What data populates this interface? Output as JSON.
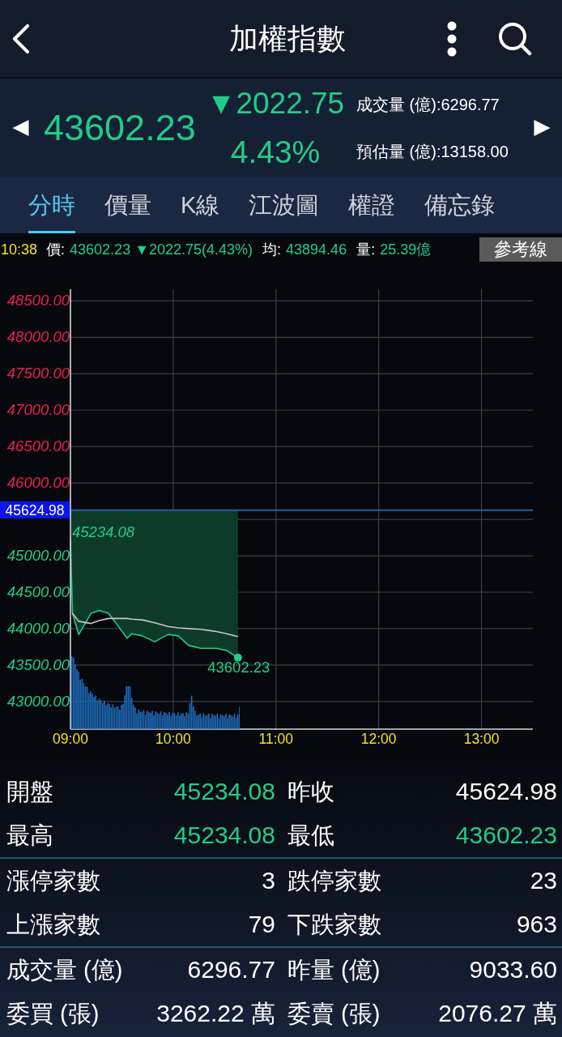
{
  "header": {
    "title": "加權指數"
  },
  "quote": {
    "price": "43602.23",
    "change": "▼2022.75",
    "percent": "4.43%",
    "volume": "成交量 (億):6296.77",
    "estimate": "預估量 (億):13158.00"
  },
  "tabs": [
    {
      "label": "分時",
      "selected": true
    },
    {
      "label": "價量",
      "selected": false
    },
    {
      "label": "K線",
      "selected": false
    },
    {
      "label": "江波圖",
      "selected": false
    },
    {
      "label": "權證",
      "selected": false
    },
    {
      "label": "備忘錄",
      "selected": false
    }
  ],
  "info_bar": {
    "time": "10:38",
    "items": [
      {
        "label": "價:",
        "value": "43602.23 ▼2022.75(4.43%)"
      },
      {
        "label": "均:",
        "value": "43894.46"
      },
      {
        "label": "量:",
        "value": "25.39億"
      }
    ],
    "button": "參考線"
  },
  "chart": {
    "chart_data": {
      "type": "line",
      "x": [
        9,
        9.02,
        9.08,
        9.2,
        9.28,
        9.37,
        9.43,
        9.55,
        9.6,
        9.7,
        9.82,
        9.95,
        10.05,
        10.15,
        10.27,
        10.42,
        10.52,
        10.63
      ],
      "series": [
        {
          "color": "#22cc88",
          "values": [
            45230,
            44210,
            43920,
            44210,
            44250,
            44210,
            44100,
            43870,
            43930,
            43900,
            43820,
            43920,
            43900,
            43770,
            43730,
            43730,
            43700,
            43600
          ]
        },
        {
          "color": "#c8c8c8",
          "values": [
            null,
            44210,
            44100,
            44070,
            44110,
            44140,
            44140,
            44140,
            44130,
            44120,
            44080,
            44030,
            44010,
            44000,
            43990,
            43960,
            43930,
            43890
          ]
        }
      ],
      "xlim": [
        9,
        13.5
      ],
      "ylim": [
        42620,
        48660
      ],
      "grid": true,
      "xticks": [
        {
          "value": 9,
          "label": "09:00"
        },
        {
          "value": 10,
          "label": "10:00"
        },
        {
          "value": 11,
          "label": "11:00"
        },
        {
          "value": 12,
          "label": "12:00"
        },
        {
          "value": 13,
          "label": "13:00"
        }
      ],
      "yticks": [
        {
          "value": 48500,
          "label": "48500.00"
        },
        {
          "value": 48000,
          "label": "48000.00"
        },
        {
          "value": 47500,
          "label": "47500.00"
        },
        {
          "value": 47000,
          "label": "47000.00"
        },
        {
          "value": 46500,
          "label": "46500.00"
        },
        {
          "value": 46000,
          "label": "46000.00"
        },
        {
          "value": 45000,
          "label": "45000.00"
        },
        {
          "value": 44500,
          "label": "44500.00"
        },
        {
          "value": 44000,
          "label": "44000.00"
        },
        {
          "value": 43500,
          "label": "43500.00"
        },
        {
          "value": 43000,
          "label": "43000.00"
        }
      ],
      "ref_lines": [
        {
          "axis": "y",
          "value": 45624.98,
          "label": "45624.98"
        }
      ],
      "annotations": [
        {
          "x": 9,
          "y": 45234.08,
          "text": "45234.08"
        },
        {
          "x": 10.63,
          "y": 43602.23,
          "text": "43602.23"
        }
      ]
    }
  },
  "stats": {
    "sections": [
      {
        "rows": [
          [
            {
              "label": "開盤",
              "value": "45234.08",
              "color": "#22cc88"
            },
            {
              "label": "昨收",
              "value": "45624.98",
              "color": "#ffffff"
            }
          ],
          [
            {
              "label": "最高",
              "value": "45234.08",
              "color": "#22cc88"
            },
            {
              "label": "最低",
              "value": "43602.23",
              "color": "#22cc88"
            }
          ]
        ]
      },
      {
        "rows": [
          [
            {
              "label": "漲停家數",
              "value": "3",
              "color": "#ffffff"
            },
            {
              "label": "跌停家數",
              "value": "23",
              "color": "#ffffff"
            }
          ],
          [
            {
              "label": "上漲家數",
              "value": "79",
              "color": "#ffffff"
            },
            {
              "label": "下跌家數",
              "value": "963",
              "color": "#ffffff"
            }
          ]
        ]
      },
      {
        "rows": [
          [
            {
              "label": "成交量 (億)",
              "value": "6296.77",
              "color": "#ffffff"
            },
            {
              "label": "昨量 (億)",
              "value": "9033.60",
              "color": "#ffffff"
            }
          ],
          [
            {
              "label": "委買 (張)",
              "value": "3262.22 萬",
              "color": "#ffffff"
            },
            {
              "label": "委賣 (張)",
              "value": "2076.27 萬",
              "color": "#ffffff"
            }
          ]
        ]
      }
    ]
  }
}
